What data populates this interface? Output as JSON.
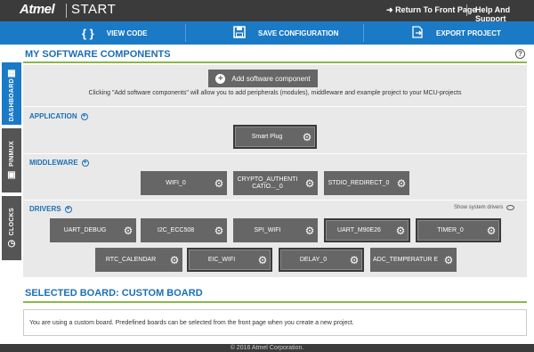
{
  "topbar": {
    "logo": "Atmel",
    "product": "START",
    "return_link": "Return To Front Page",
    "help_link": "Help And Support"
  },
  "actions": {
    "view_code": "VIEW CODE",
    "save_configuration": "SAVE CONFIGURATION",
    "export_project": "EXPORT PROJECT"
  },
  "sidetabs": {
    "dashboard": "DASHBOARD",
    "pinmux": "PINMUX",
    "clocks": "CLOCKS"
  },
  "software": {
    "title": "MY SOFTWARE COMPONENTS",
    "help": "?",
    "add_button": "Add software component",
    "hint": "Clicking \"Add software components\" will allow you to add peripherals (modules), middleware and example project to your MCU-projects"
  },
  "sections": {
    "application": "APPLICATION",
    "middleware": "MIDDLEWARE",
    "drivers": "DRIVERS",
    "show_system_drivers": "Show system drivers"
  },
  "components": {
    "application": [
      "Smart Plug"
    ],
    "middleware": [
      "WIFI_0",
      "CRYPTO_AUTHENTI CATIO..._0",
      "STDIO_REDIRECT_0"
    ],
    "drivers_row1": [
      "UART_DEBUG",
      "I2C_ECC508",
      "SPI_WIFI",
      "UART_M90E26",
      "TIMER_0"
    ],
    "drivers_row2": [
      "RTC_CALENDAR",
      "EIC_WIFI",
      "DELAY_0",
      "ADC_TEMPERATUR E"
    ]
  },
  "board": {
    "title": "SELECTED BOARD: CUSTOM BOARD",
    "text": "You are using a custom board. Predefined boards can be selected from the front page when you create a new project."
  },
  "footer": "© 2016 Atmel Corporation.",
  "colors": {
    "accent_blue": "#1b7ac6",
    "accent_green": "#89b84a",
    "component_gray": "#666666"
  }
}
